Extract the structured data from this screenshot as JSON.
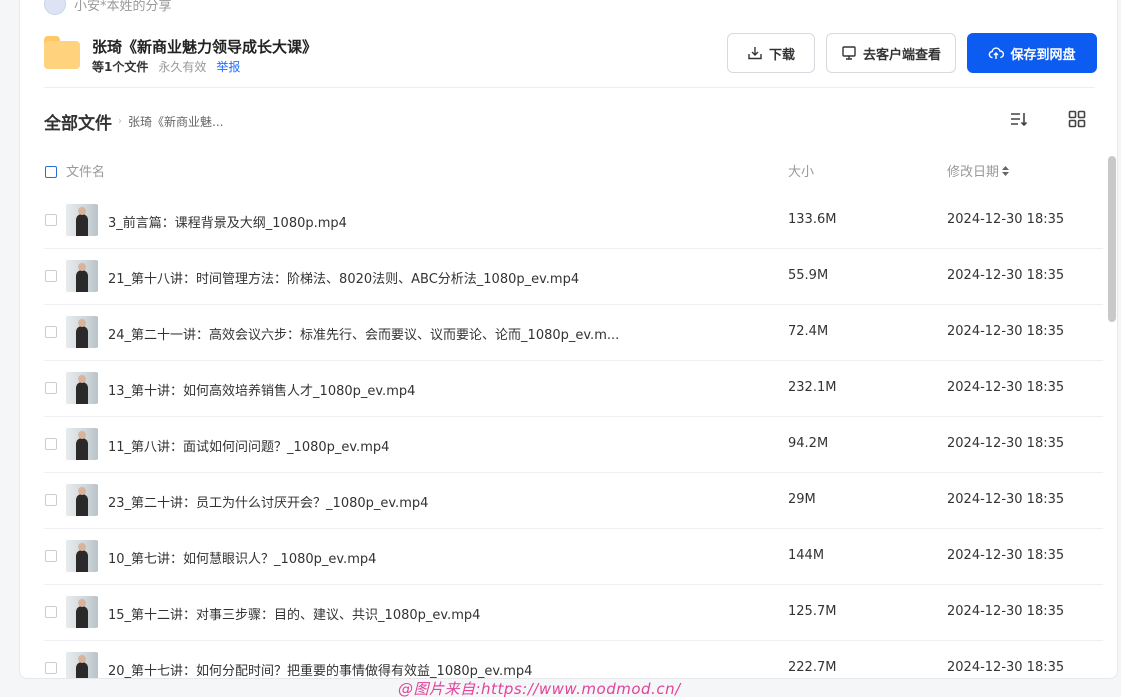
{
  "sharer": {
    "text": "小安*本姓的分享"
  },
  "share": {
    "title": "张琦《新商业魅力领导成长大课》",
    "count": "等1个文件",
    "validity": "永久有效",
    "report": "举报"
  },
  "buttons": {
    "download": "下载",
    "client": "去客户端查看",
    "save": "保存到网盘"
  },
  "breadcrumb": {
    "root": "全部文件",
    "current": "张琦《新商业魅..."
  },
  "table": {
    "headers": {
      "name": "文件名",
      "size": "大小",
      "date": "修改日期"
    },
    "rows": [
      {
        "name": "3_前言篇：课程背景及大纲_1080p.mp4",
        "size": "133.6M",
        "date": "2024-12-30 18:35"
      },
      {
        "name": "21_第十八讲：时间管理方法：阶梯法、8020法则、ABC分析法_1080p_ev.mp4",
        "size": "55.9M",
        "date": "2024-12-30 18:35"
      },
      {
        "name": "24_第二十一讲：高效会议六步：标准先行、会而要议、议而要论、论而_1080p_ev.m...",
        "size": "72.4M",
        "date": "2024-12-30 18:35"
      },
      {
        "name": "13_第十讲：如何高效培养销售人才_1080p_ev.mp4",
        "size": "232.1M",
        "date": "2024-12-30 18:35"
      },
      {
        "name": "11_第八讲：面试如何问问题？_1080p_ev.mp4",
        "size": "94.2M",
        "date": "2024-12-30 18:35"
      },
      {
        "name": "23_第二十讲：员工为什么讨厌开会？_1080p_ev.mp4",
        "size": "29M",
        "date": "2024-12-30 18:35"
      },
      {
        "name": "10_第七讲：如何慧眼识人？_1080p_ev.mp4",
        "size": "144M",
        "date": "2024-12-30 18:35"
      },
      {
        "name": "15_第十二讲：对事三步骤：目的、建议、共识_1080p_ev.mp4",
        "size": "125.7M",
        "date": "2024-12-30 18:35"
      },
      {
        "name": "20_第十七讲：如何分配时间？把重要的事情做得有效益_1080p_ev.mp4",
        "size": "222.7M",
        "date": "2024-12-30 18:35"
      }
    ]
  },
  "watermark": "@图片来自:https://www.modmod.cn/",
  "colors": {
    "primary": "#0d5cf2",
    "link": "#1e6fff",
    "watermark": "#e0449a"
  }
}
